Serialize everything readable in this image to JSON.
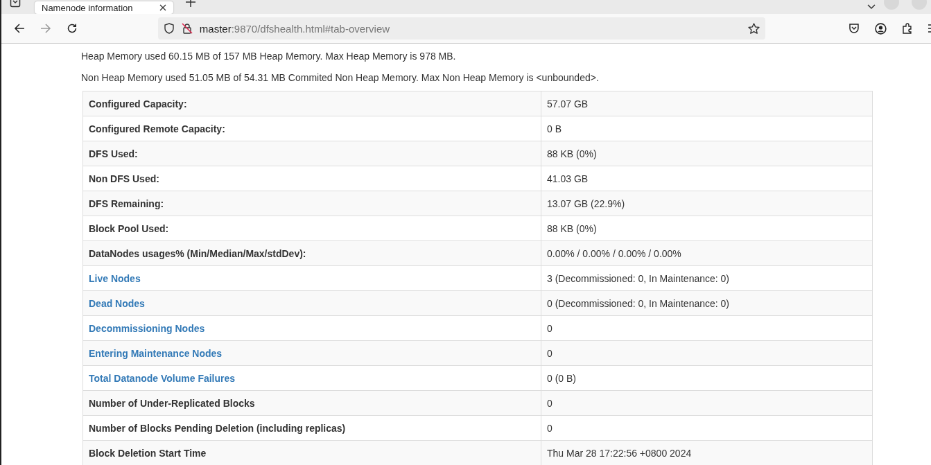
{
  "browser": {
    "tab_title": "Namenode information",
    "url_host": "master",
    "url_rest": ":9870/dfshealth.html#tab-overview"
  },
  "memory_lines": [
    "Heap Memory used 60.15 MB of 157 MB Heap Memory. Max Heap Memory is 978 MB.",
    "Non Heap Memory used 51.05 MB of 54.31 MB Commited Non Heap Memory. Max Non Heap Memory is <unbounded>."
  ],
  "table": {
    "rows": [
      {
        "kind": "label",
        "label": "Configured Capacity:",
        "value": "57.07 GB"
      },
      {
        "kind": "label",
        "label": "Configured Remote Capacity:",
        "value": "0 B"
      },
      {
        "kind": "label",
        "label": "DFS Used:",
        "value": "88 KB (0%)"
      },
      {
        "kind": "label",
        "label": "Non DFS Used:",
        "value": "41.03 GB"
      },
      {
        "kind": "label",
        "label": "DFS Remaining:",
        "value": "13.07 GB (22.9%)"
      },
      {
        "kind": "label",
        "label": "Block Pool Used:",
        "value": "88 KB (0%)"
      },
      {
        "kind": "label",
        "label": "DataNodes usages% (Min/Median/Max/stdDev):",
        "value": "0.00% / 0.00% / 0.00% / 0.00%"
      },
      {
        "kind": "link",
        "label": "Live Nodes",
        "value": "3 (Decommissioned: 0, In Maintenance: 0)"
      },
      {
        "kind": "link",
        "label": "Dead Nodes",
        "value": "0 (Decommissioned: 0, In Maintenance: 0)"
      },
      {
        "kind": "link",
        "label": "Decommissioning Nodes",
        "value": "0"
      },
      {
        "kind": "link",
        "label": "Entering Maintenance Nodes",
        "value": "0"
      },
      {
        "kind": "link",
        "label": "Total Datanode Volume Failures",
        "value": "0 (0 B)"
      },
      {
        "kind": "label",
        "label": "Number of Under-Replicated Blocks",
        "value": "0"
      },
      {
        "kind": "label",
        "label": "Number of Blocks Pending Deletion (including replicas)",
        "value": "0"
      },
      {
        "kind": "label",
        "label": "Block Deletion Start Time",
        "value": "Thu Mar 28 17:22:56 +0800 2024"
      }
    ]
  }
}
